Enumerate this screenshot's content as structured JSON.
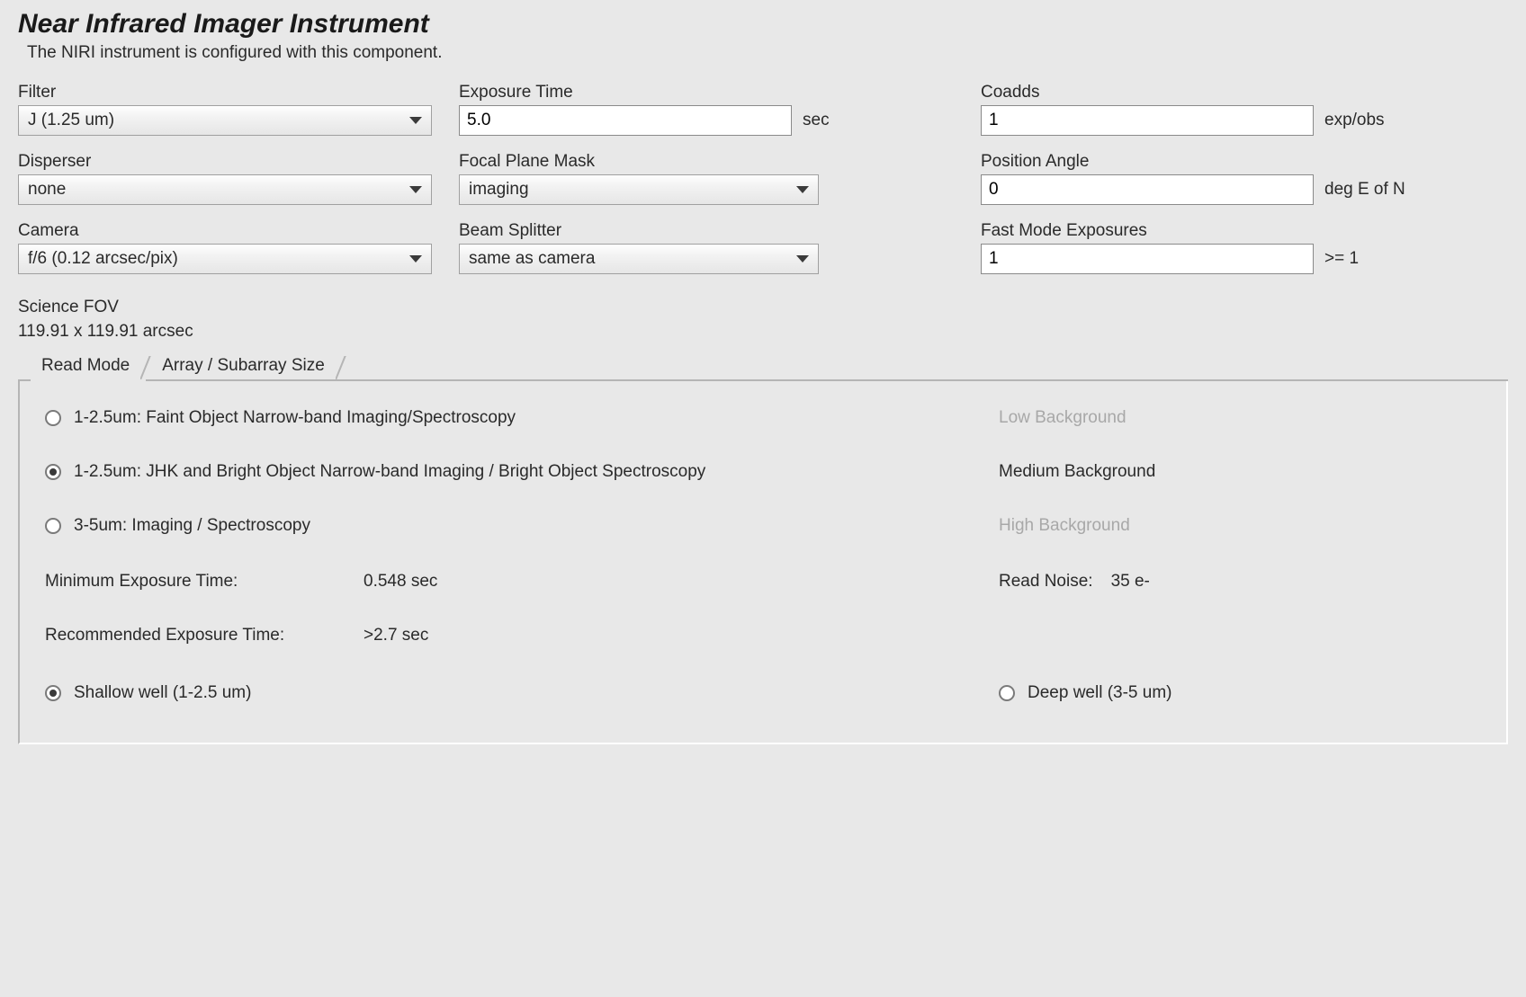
{
  "header": {
    "title": "Near Infrared Imager Instrument",
    "subtitle": "The NIRI instrument is configured with this component."
  },
  "fields": {
    "filter": {
      "label": "Filter",
      "value": "J (1.25 um)"
    },
    "exposure_time": {
      "label": "Exposure Time",
      "value": "5.0",
      "unit": "sec"
    },
    "coadds": {
      "label": "Coadds",
      "value": "1",
      "unit": "exp/obs"
    },
    "disperser": {
      "label": "Disperser",
      "value": "none"
    },
    "focal_plane_mask": {
      "label": "Focal Plane Mask",
      "value": "imaging"
    },
    "position_angle": {
      "label": "Position Angle",
      "value": "0",
      "unit": "deg E of N"
    },
    "camera": {
      "label": "Camera",
      "value": "f/6 (0.12 arcsec/pix)"
    },
    "beam_splitter": {
      "label": "Beam Splitter",
      "value": "same as camera"
    },
    "fast_mode": {
      "label": "Fast Mode Exposures",
      "value": "1",
      "unit": ">= 1"
    }
  },
  "science_fov": {
    "label": "Science FOV",
    "value": "119.91 x 119.91 arcsec"
  },
  "tabs": {
    "read_mode": "Read Mode",
    "array_size": "Array / Subarray Size"
  },
  "read_mode_panel": {
    "options": {
      "opt1": {
        "label": "1-2.5um: Faint Object Narrow-band Imaging/Spectroscopy",
        "bg": "Low Background"
      },
      "opt2": {
        "label": "1-2.5um: JHK and Bright Object Narrow-band Imaging / Bright Object Spectroscopy",
        "bg": "Medium Background"
      },
      "opt3": {
        "label": "3-5um: Imaging / Spectroscopy",
        "bg": "High Background"
      }
    },
    "min_exp": {
      "label": "Minimum Exposure Time:",
      "value": "0.548 sec"
    },
    "read_noise": {
      "label": "Read Noise:",
      "value": "35 e-"
    },
    "rec_exp": {
      "label": "Recommended Exposure Time:",
      "value": ">2.7 sec"
    },
    "wells": {
      "shallow": "Shallow well (1-2.5 um)",
      "deep": "Deep well (3-5 um)"
    }
  }
}
